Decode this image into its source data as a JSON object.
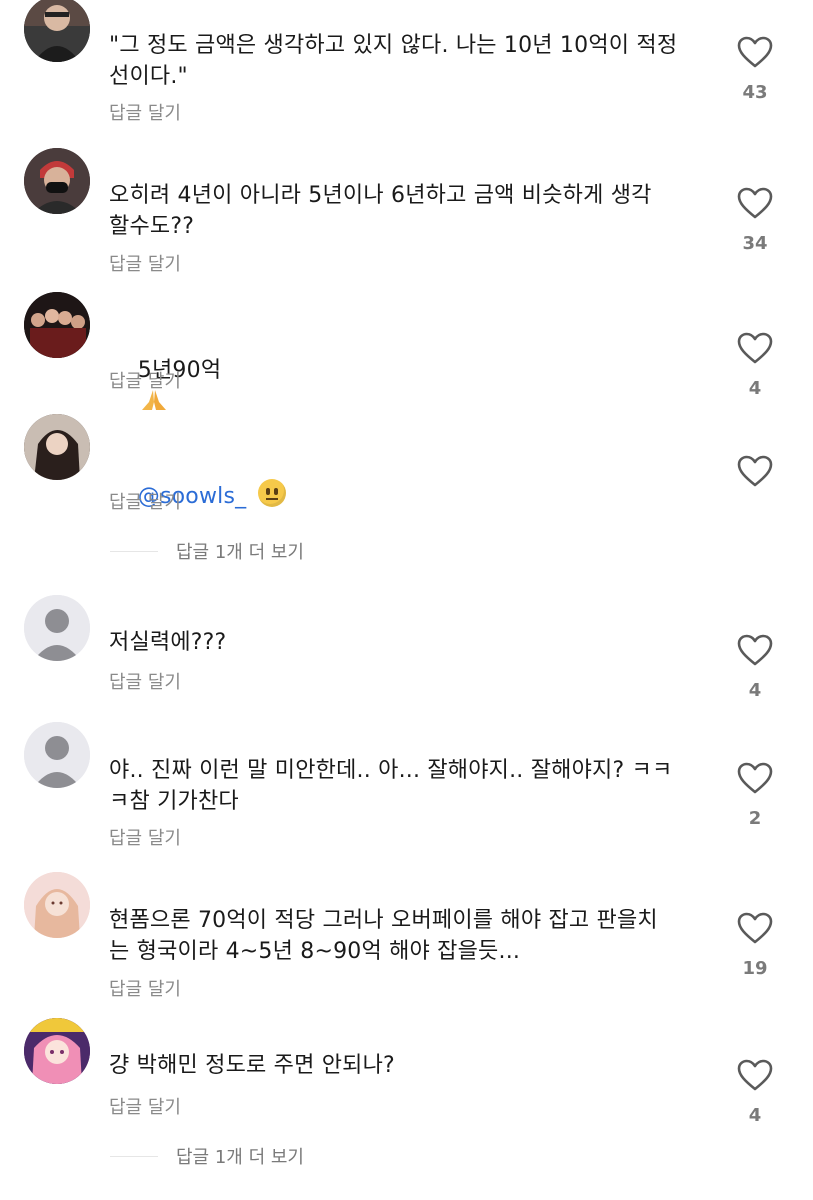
{
  "comments": [
    {
      "text": "\"그 정도 금액은 생각하고 있지 않다. 나는 10년 10억이 적정\n선이다.\"",
      "reply": "답글 달기",
      "likes": "43"
    },
    {
      "text": "오히려 4년이 아니라 5년이나 6년하고 금액 비슷하게 생각\n할수도??",
      "reply": "답글 달기",
      "likes": "34"
    },
    {
      "text": "5년90억",
      "reply": "답글 달기",
      "likes": "4"
    },
    {
      "mention": "@soowls_",
      "reply": "답글 달기",
      "likes": ""
    },
    {
      "text": "저실력에???",
      "reply": "답글 달기",
      "likes": "4"
    },
    {
      "text": "야.. 진짜 이런 말 미안한데.. 아... 잘해야지.. 잘해야지? ㅋㅋ\nㅋ참 기가찬다",
      "reply": "답글 달기",
      "likes": "2"
    },
    {
      "text": "현폼으론 70억이 적당 그러나 오버페이를 해야 잡고 판을치\n는 형국이라 4~5년 8~90억 해야 잡을듯...",
      "reply": "답글 달기",
      "likes": "19"
    },
    {
      "text": "걍 박해민 정도로 주면 안되나?",
      "reply": "답글 달기",
      "likes": "4"
    }
  ],
  "more_replies": [
    "답글 1개 더 보기",
    "답글 1개 더 보기"
  ],
  "icons": {
    "like": "heart-outline-icon",
    "pray": "folded-hands-emoji",
    "face": "neutral-face-emoji"
  },
  "colors": {
    "mention": "#2b6cd6",
    "secondary_text": "#8a8a8a"
  }
}
